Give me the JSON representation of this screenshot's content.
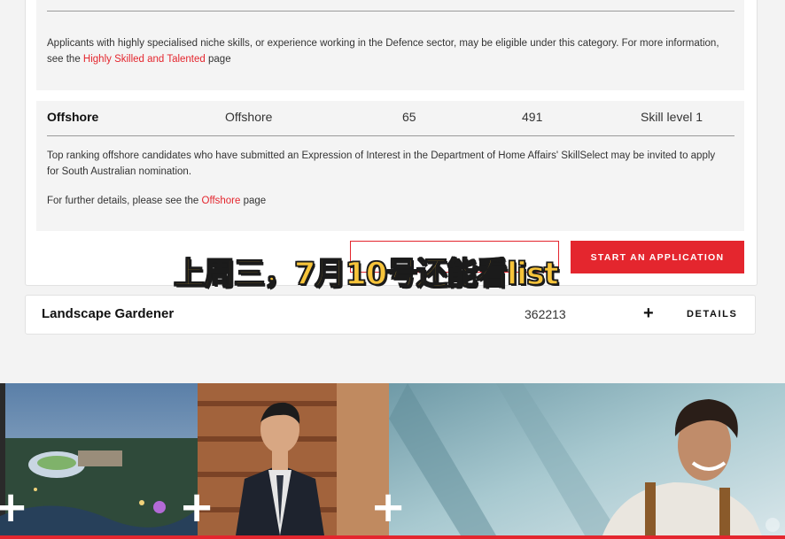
{
  "skilled_block": {
    "text_before": "Applicants with highly specialised niche skills, or experience working in the Defence sector, may be eligible under this category. For more information, see the ",
    "link": "Highly Skilled and Talented",
    "text_after": " page"
  },
  "offshore_row": {
    "title": "Offshore",
    "stream": "Offshore",
    "points": "65",
    "code": "491",
    "skill_level": "Skill level 1",
    "description": "Top ranking offshore candidates who have submitted an Expression of Interest in the Department of Home Affairs' SkillSelect may be invited to apply for South Australian nomination.",
    "details_before": "For further details, please see the ",
    "details_link": "Offshore",
    "details_after": " page"
  },
  "actions": {
    "start_application": "START AN APPLICATION"
  },
  "occupation": {
    "name": "Landscape Gardener",
    "code": "362213",
    "expand": "+",
    "details": "DETAILS"
  },
  "overlay_caption": "上周三，7月10号还能看list",
  "colors": {
    "accent": "#e4262e",
    "panel": "#f4f4f4",
    "caption": "#f7c43a"
  },
  "banner": {
    "tiles": [
      "city-aerial-photo",
      "businessman-photo",
      "young-man-photo"
    ],
    "plus": "+"
  }
}
